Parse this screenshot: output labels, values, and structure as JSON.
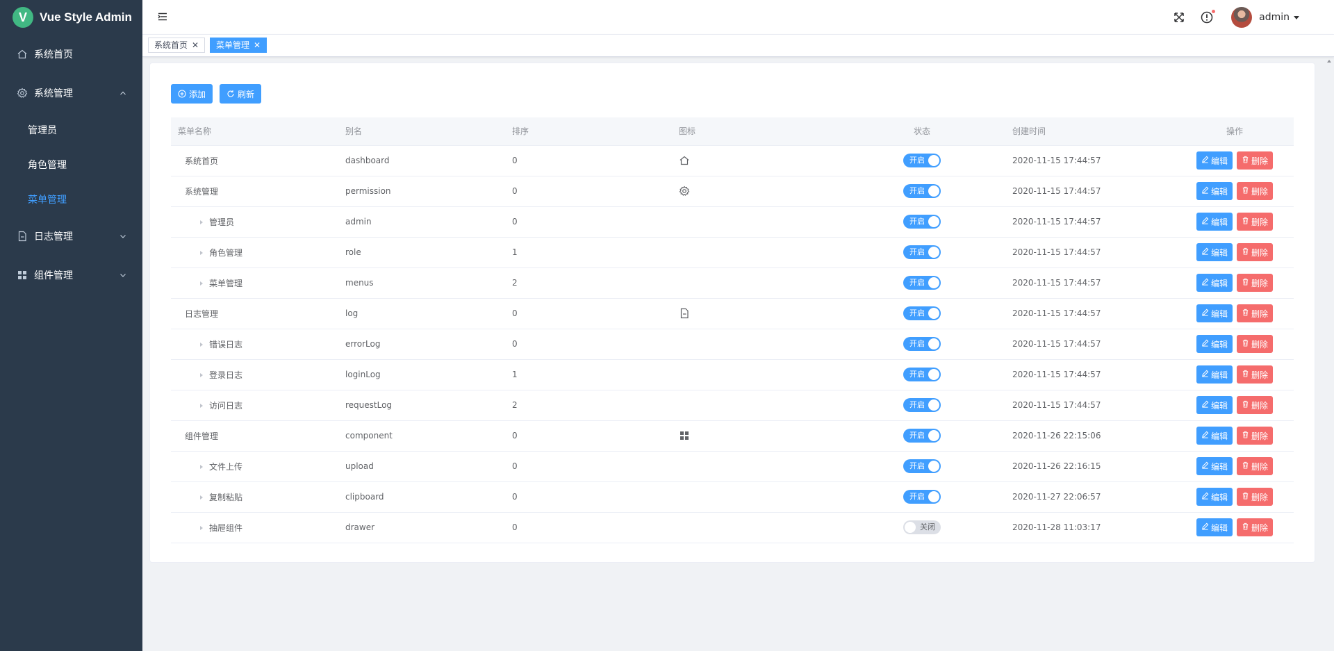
{
  "brand": {
    "logo_letter": "V",
    "title": "Vue Style Admin"
  },
  "sidebar": {
    "items": [
      {
        "label": "系统首页",
        "icon": "home-icon"
      },
      {
        "label": "系统管理",
        "icon": "gear-icon",
        "expanded": true,
        "children": [
          {
            "label": "管理员"
          },
          {
            "label": "角色管理"
          },
          {
            "label": "菜单管理",
            "active": true
          }
        ]
      },
      {
        "label": "日志管理",
        "icon": "document-icon"
      },
      {
        "label": "组件管理",
        "icon": "grid-icon"
      }
    ]
  },
  "header": {
    "username": "admin"
  },
  "tags": [
    {
      "label": "系统首页",
      "active": false
    },
    {
      "label": "菜单管理",
      "active": true
    }
  ],
  "toolbar": {
    "add_label": "添加",
    "refresh_label": "刷新"
  },
  "table": {
    "columns": [
      "菜单名称",
      "别名",
      "排序",
      "图标",
      "状态",
      "创建时间",
      "操作"
    ],
    "edit_label": "编辑",
    "delete_label": "删除",
    "switch_on_label": "开启",
    "switch_off_label": "关闭",
    "rows": [
      {
        "name": "系统首页",
        "alias": "dashboard",
        "sort": "0",
        "icon": "home-icon",
        "level": 0,
        "status": true,
        "created": "2020-11-15 17:44:57"
      },
      {
        "name": "系统管理",
        "alias": "permission",
        "sort": "0",
        "icon": "gear-icon",
        "level": 0,
        "status": true,
        "created": "2020-11-15 17:44:57"
      },
      {
        "name": "管理员",
        "alias": "admin",
        "sort": "0",
        "icon": "",
        "level": 1,
        "status": true,
        "created": "2020-11-15 17:44:57"
      },
      {
        "name": "角色管理",
        "alias": "role",
        "sort": "1",
        "icon": "",
        "level": 1,
        "status": true,
        "created": "2020-11-15 17:44:57"
      },
      {
        "name": "菜单管理",
        "alias": "menus",
        "sort": "2",
        "icon": "",
        "level": 1,
        "status": true,
        "created": "2020-11-15 17:44:57"
      },
      {
        "name": "日志管理",
        "alias": "log",
        "sort": "0",
        "icon": "document-icon",
        "level": 0,
        "status": true,
        "created": "2020-11-15 17:44:57"
      },
      {
        "name": "错误日志",
        "alias": "errorLog",
        "sort": "0",
        "icon": "",
        "level": 1,
        "status": true,
        "created": "2020-11-15 17:44:57"
      },
      {
        "name": "登录日志",
        "alias": "loginLog",
        "sort": "1",
        "icon": "",
        "level": 1,
        "status": true,
        "created": "2020-11-15 17:44:57"
      },
      {
        "name": "访问日志",
        "alias": "requestLog",
        "sort": "2",
        "icon": "",
        "level": 1,
        "status": true,
        "created": "2020-11-15 17:44:57"
      },
      {
        "name": "组件管理",
        "alias": "component",
        "sort": "0",
        "icon": "grid-icon",
        "level": 0,
        "status": true,
        "created": "2020-11-26 22:15:06"
      },
      {
        "name": "文件上传",
        "alias": "upload",
        "sort": "0",
        "icon": "",
        "level": 1,
        "status": true,
        "created": "2020-11-26 22:16:15"
      },
      {
        "name": "复制粘贴",
        "alias": "clipboard",
        "sort": "0",
        "icon": "",
        "level": 1,
        "status": true,
        "created": "2020-11-27 22:06:57"
      },
      {
        "name": "抽屉组件",
        "alias": "drawer",
        "sort": "0",
        "icon": "",
        "level": 1,
        "status": false,
        "created": "2020-11-28 11:03:17"
      }
    ]
  },
  "colors": {
    "primary": "#409eff",
    "danger": "#f56c6c",
    "sidebar_bg": "#2b3a4b",
    "brand_green": "#41b883"
  }
}
